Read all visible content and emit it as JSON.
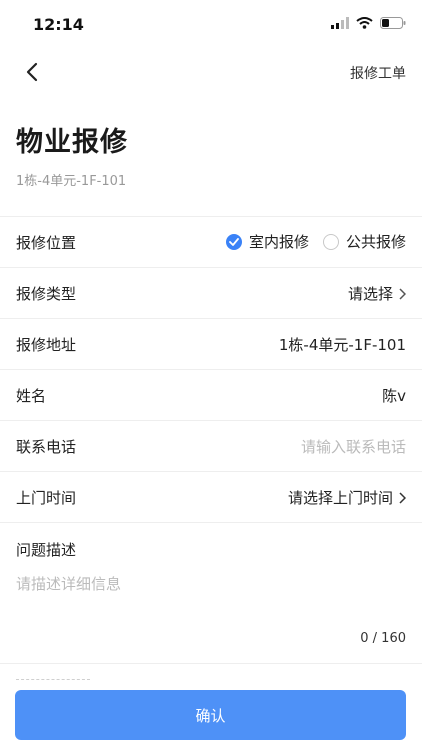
{
  "status_bar": {
    "time": "12:14"
  },
  "nav": {
    "right_label": "报修工单"
  },
  "page": {
    "title": "物业报修",
    "subtitle": "1栋-4单元-1F-101"
  },
  "form": {
    "location": {
      "label": "报修位置",
      "options": [
        "室内报修",
        "公共报修"
      ],
      "selected": "室内报修"
    },
    "type": {
      "label": "报修类型",
      "value": "请选择"
    },
    "address": {
      "label": "报修地址",
      "value": "1栋-4单元-1F-101"
    },
    "name": {
      "label": "姓名",
      "value": "陈v"
    },
    "phone": {
      "label": "联系电话",
      "placeholder": "请输入联系电话"
    },
    "visit_time": {
      "label": "上门时间",
      "value": "请选择上门时间"
    },
    "description": {
      "label": "问题描述",
      "placeholder": "请描述详细信息",
      "counter": "0 / 160"
    }
  },
  "actions": {
    "confirm_label": "确认"
  },
  "colors": {
    "accent": "#3a82f7",
    "button": "#4e91f7",
    "placeholder": "#bbbbbb"
  }
}
